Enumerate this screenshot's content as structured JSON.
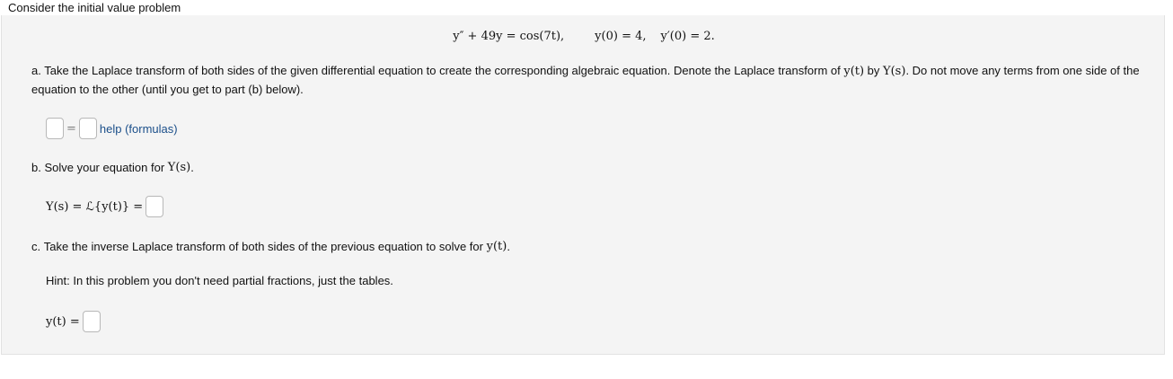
{
  "intro": "Consider the initial value problem",
  "equation": {
    "ode_lhs": "y″ + 49y = cos(7t),",
    "ic1": "y(0) = 4,",
    "ic2": "y′(0) = 2."
  },
  "part_a": {
    "marker": "a.",
    "text_1": "Take the Laplace transform of both sides of the given differential equation to create the corresponding algebraic equation. Denote the Laplace transform of ",
    "yt": "y(t)",
    "by": " by ",
    "Ys": "Y(s)",
    "text_2": ". Do not move any terms from one side of the equation to the other (until you get to part (b) below).",
    "equals": "=",
    "help_link": "help (formulas)"
  },
  "part_b": {
    "marker": "b.",
    "text": "Solve your equation for ",
    "Ys": "Y(s)",
    "period": ".",
    "answer_label": "Y(s) = ℒ{y(t)} =",
    "equals": "="
  },
  "part_c": {
    "marker": "c.",
    "text": "Take the inverse Laplace transform of both sides of the previous equation to solve for ",
    "yt": "y(t)",
    "period": ".",
    "hint": "Hint: In this problem you don't need partial fractions, just the tables.",
    "answer_label": "y(t) =",
    "equals": "="
  }
}
